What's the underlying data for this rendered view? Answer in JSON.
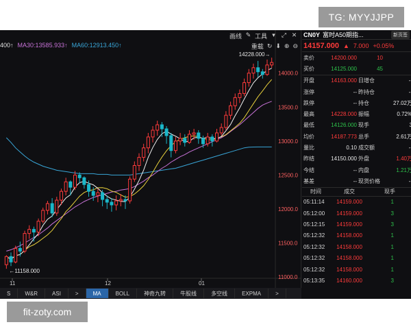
{
  "watermarks": {
    "top": "TG: MYYJJPP",
    "bottom": "fit-zoty.com"
  },
  "chart": {
    "tools_top": [
      "画线",
      "工具"
    ],
    "tools_second": "重载",
    "ma_legend": [
      {
        "label": "400↑",
        "color": "#e0e0e0"
      },
      {
        "label": "MA30:13585.933↑",
        "color": "#c873d8"
      },
      {
        "label": "MA60:12913.450↑",
        "color": "#39a6d8"
      }
    ],
    "price_axis": [
      "14000.0",
      "13500.0",
      "13000.0",
      "12500.0",
      "12000.0",
      "11500.0",
      "11000.0"
    ],
    "date_axis": [
      "11",
      "12",
      "01"
    ],
    "high_label": "14228.000",
    "low_label": "11158.000",
    "colors": {
      "up": "#ff3b3b",
      "down": "#1bb7c9",
      "ma5": "#f0f0f0",
      "ma10": "#e8d03c",
      "ma20": "#c873d8",
      "ma60": "#39a6d8"
    }
  },
  "chart_data": {
    "type": "candlestick",
    "ylim": [
      10980,
      14330
    ],
    "candles": [
      [
        11180,
        11300,
        11120,
        11320
      ],
      [
        11300,
        11220,
        11160,
        11360
      ],
      [
        11220,
        11420,
        11200,
        11460
      ],
      [
        11420,
        11380,
        11300,
        11520
      ],
      [
        11380,
        11640,
        11350,
        11680
      ],
      [
        11640,
        11700,
        11560,
        11760
      ],
      [
        11700,
        11660,
        11520,
        11740
      ],
      [
        11660,
        11820,
        11600,
        11860
      ],
      [
        11820,
        11980,
        11790,
        12020
      ],
      [
        11980,
        12080,
        11920,
        12120
      ],
      [
        12080,
        11940,
        11880,
        12160
      ],
      [
        11940,
        12130,
        11900,
        12180
      ],
      [
        12130,
        12260,
        12060,
        12300
      ],
      [
        12260,
        12400,
        12200,
        12460
      ],
      [
        12400,
        12320,
        12200,
        12420
      ],
      [
        12320,
        12500,
        12280,
        12560
      ],
      [
        12500,
        12460,
        12380,
        12540
      ],
      [
        12460,
        12360,
        12300,
        12480
      ],
      [
        12360,
        12260,
        12180,
        12420
      ],
      [
        12260,
        12200,
        12120,
        12320
      ],
      [
        12200,
        12240,
        12100,
        12300
      ],
      [
        12240,
        12140,
        12040,
        12280
      ],
      [
        12140,
        12100,
        12000,
        12200
      ],
      [
        12100,
        12060,
        11960,
        12160
      ],
      [
        12060,
        12120,
        11980,
        12200
      ],
      [
        12120,
        12140,
        12040,
        12220
      ],
      [
        12140,
        12120,
        12000,
        12200
      ],
      [
        12120,
        12440,
        12080,
        12480
      ],
      [
        12440,
        12640,
        12400,
        12700
      ],
      [
        12640,
        12760,
        12560,
        12820
      ],
      [
        12760,
        12900,
        12700,
        12960
      ],
      [
        12900,
        13060,
        12820,
        13120
      ],
      [
        13060,
        13160,
        12980,
        13220
      ],
      [
        13160,
        13240,
        13080,
        13300
      ],
      [
        13240,
        13180,
        13060,
        13280
      ],
      [
        13180,
        13080,
        12960,
        13220
      ],
      [
        13080,
        12860,
        12760,
        13120
      ],
      [
        12860,
        13000,
        12820,
        13060
      ],
      [
        13000,
        13040,
        12940,
        13120
      ],
      [
        13040,
        12980,
        12920,
        13100
      ],
      [
        12980,
        13100,
        12960,
        13160
      ],
      [
        13100,
        13120,
        13020,
        13180
      ],
      [
        13120,
        13040,
        12960,
        13160
      ],
      [
        13040,
        12960,
        12900,
        13080
      ],
      [
        12960,
        13060,
        12920,
        13120
      ],
      [
        13060,
        13000,
        12920,
        13100
      ],
      [
        13000,
        13120,
        12980,
        13180
      ],
      [
        13120,
        13200,
        13080,
        13260
      ],
      [
        13200,
        13380,
        13160,
        13440
      ],
      [
        13380,
        13520,
        13320,
        13580
      ],
      [
        13520,
        13640,
        13460,
        13700
      ],
      [
        13640,
        13700,
        13560,
        13760
      ],
      [
        13700,
        13860,
        13660,
        13920
      ],
      [
        13860,
        14000,
        13800,
        14060
      ],
      [
        14000,
        14080,
        13920,
        14140
      ],
      [
        14080,
        14020,
        13940,
        14180
      ],
      [
        14020,
        13980,
        13920,
        14060
      ],
      [
        13980,
        14120,
        13960,
        14200
      ],
      [
        14120,
        14157,
        14080,
        14228
      ]
    ],
    "ma_series": [
      {
        "name": "MA30",
        "values": [
          11380,
          11400,
          11430,
          11460,
          11500,
          11540,
          11580,
          11620,
          11670,
          11720,
          11780,
          11830,
          11880,
          11930,
          11980,
          12030,
          12070,
          12110,
          12140,
          12170,
          12190,
          12210,
          12230,
          12250,
          12260,
          12280,
          12290,
          12300,
          12330,
          12370,
          12410,
          12460,
          12500,
          12550,
          12600,
          12640,
          12690,
          12730,
          12770,
          12800,
          12840,
          12870,
          12900,
          12930,
          12960,
          12990,
          13020,
          13050,
          13090,
          13140,
          13190,
          13240,
          13300,
          13360,
          13420,
          13480,
          13530,
          13560,
          13585
        ]
      },
      {
        "name": "MA60",
        "values": [
          13050,
          12980,
          12900,
          12840,
          12780,
          12730,
          12690,
          12660,
          12630,
          12610,
          12590,
          12570,
          12560,
          12550,
          12540,
          12530,
          12520,
          12520,
          12520,
          12520,
          12510,
          12510,
          12510,
          12500,
          12500,
          12500,
          12500,
          12500,
          12510,
          12520,
          12530,
          12540,
          12550,
          12560,
          12570,
          12580,
          12590,
          12600,
          12620,
          12640,
          12660,
          12680,
          12700,
          12720,
          12740,
          12760,
          12780,
          12800,
          12820,
          12840,
          12860,
          12880,
          12900,
          12910,
          12912,
          12913,
          12913,
          12913,
          12913
        ]
      }
    ]
  },
  "tabs": [
    "S",
    "W&R",
    "ASI",
    ">",
    "MA",
    "BOLL",
    "神奇九转",
    "牛股线",
    "多空线",
    "EXPMA",
    ">"
  ],
  "panel": {
    "code": "CN0Y",
    "name": "富时A50期指...",
    "button": "新页签",
    "price": "14157.000",
    "change": "7.000",
    "change_pct": "+0.05%",
    "bid_ask": [
      {
        "label": "卖价",
        "value": "14200.000",
        "vol": "10",
        "color": "red"
      },
      {
        "label": "买价",
        "value": "14125.000",
        "vol": "45",
        "color": "green"
      }
    ],
    "stats": [
      {
        "l1": "开盘",
        "v1": "14163.000",
        "c1": "red",
        "l2": "日增仓",
        "v2": "--",
        "c2": "white"
      },
      {
        "l1": "涨停",
        "v1": "--",
        "c1": "white",
        "l2": "昨持仓",
        "v2": "--",
        "c2": "white"
      },
      {
        "l1": "跌停",
        "v1": "--",
        "c1": "white",
        "l2": "持仓",
        "v2": "27.02万",
        "c2": "white"
      },
      {
        "l1": "最高",
        "v1": "14228.000",
        "c1": "red",
        "l2": "振幅",
        "v2": "0.72%",
        "c2": "white"
      },
      {
        "l1": "最低",
        "v1": "14126.000",
        "c1": "green",
        "l2": "现手",
        "v2": "3",
        "c2": "white"
      },
      {
        "l1": "均价",
        "v1": "14187.773",
        "c1": "red",
        "l2": "总手",
        "v2": "2.61万",
        "c2": "white"
      },
      {
        "l1": "量比",
        "v1": "0.10",
        "c1": "white",
        "l2": "成交额",
        "v2": "--",
        "c2": "white"
      },
      {
        "l1": "昨结",
        "v1": "14150.000",
        "c1": "white",
        "l2": "外盘",
        "v2": "1.40万",
        "c2": "red"
      },
      {
        "l1": "今结",
        "v1": "--",
        "c1": "white",
        "l2": "内盘",
        "v2": "1.21万",
        "c2": "green"
      },
      {
        "l1": "基差",
        "v1": "--",
        "c1": "white",
        "l2": "现货价格",
        "v2": "--",
        "c2": "white"
      }
    ],
    "trade_header": [
      "时间",
      "成交",
      "现手"
    ],
    "trades": [
      {
        "time": "05:11:14",
        "price": "14159.000",
        "qty": "1"
      },
      {
        "time": "05:12:00",
        "price": "14159.000",
        "qty": "3"
      },
      {
        "time": "05:12:15",
        "price": "14159.000",
        "qty": "3"
      },
      {
        "time": "05:12:32",
        "price": "14158.000",
        "qty": "1"
      },
      {
        "time": "05:12:32",
        "price": "14158.000",
        "qty": "1"
      },
      {
        "time": "05:12:32",
        "price": "14158.000",
        "qty": "1"
      },
      {
        "time": "05:12:32",
        "price": "14158.000",
        "qty": "1"
      },
      {
        "time": "05:13:35",
        "price": "14160.000",
        "qty": "3"
      }
    ]
  }
}
